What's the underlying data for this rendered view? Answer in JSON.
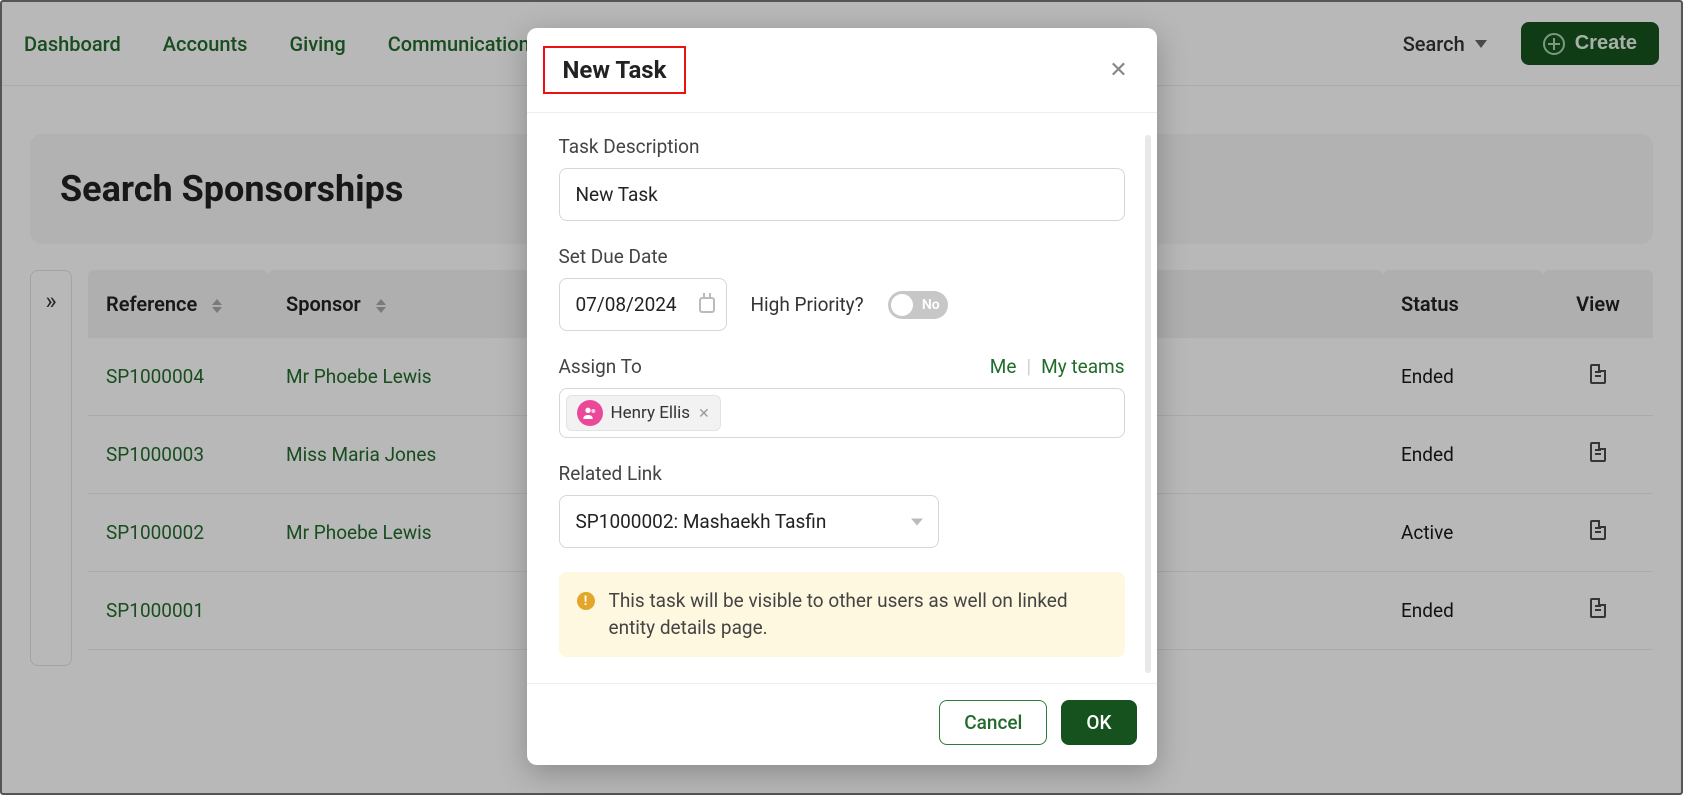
{
  "nav": {
    "items": [
      "Dashboard",
      "Accounts",
      "Giving",
      "Communication"
    ],
    "search_label": "Search",
    "create_label": "Create"
  },
  "page": {
    "heading": "Search Sponsorships"
  },
  "table": {
    "columns": {
      "reference": "Reference",
      "sponsor": "Sponsor",
      "status": "Status",
      "view": "View"
    },
    "rows": [
      {
        "reference": "SP1000004",
        "sponsor": "Mr Phoebe Lewis",
        "status": "Ended"
      },
      {
        "reference": "SP1000003",
        "sponsor": "Miss Maria Jones",
        "status": "Ended"
      },
      {
        "reference": "SP1000002",
        "sponsor": "Mr Phoebe Lewis",
        "status": "Active"
      },
      {
        "reference": "SP1000001",
        "sponsor": "",
        "status": "Ended"
      }
    ]
  },
  "modal": {
    "title": "New Task",
    "labels": {
      "description": "Task Description",
      "due_date": "Set Due Date",
      "priority": "High Priority?",
      "assign_to": "Assign To",
      "related_link": "Related Link"
    },
    "description_value": "New Task",
    "due_date_value": "07/08/2024",
    "priority_value_text": "No",
    "priority_on": false,
    "assign_links": {
      "me": "Me",
      "my_teams": "My teams"
    },
    "assignees": [
      {
        "name": "Henry Ellis"
      }
    ],
    "related_link_value": "SP1000002: Mashaekh Tasfin",
    "notice_text": "This task will be visible to other users as well on linked entity details page.",
    "buttons": {
      "cancel": "Cancel",
      "ok": "OK"
    }
  }
}
